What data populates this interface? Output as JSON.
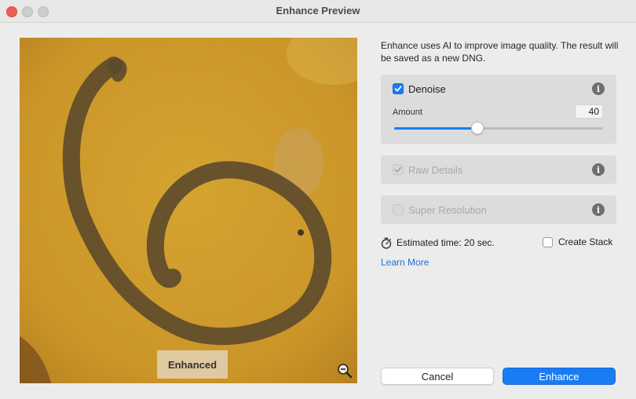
{
  "window": {
    "title": "Enhance Preview"
  },
  "preview": {
    "badge_label": "Enhanced",
    "zoom_icon": "zoom-out-icon"
  },
  "panel": {
    "description": "Enhance uses AI to improve image quality. The result will be saved as a new DNG.",
    "denoise": {
      "label": "Denoise",
      "checked": true,
      "amount_label": "Amount",
      "amount_value": "40",
      "amount_fraction": 0.4
    },
    "raw_details": {
      "label": "Raw Details",
      "checked": true,
      "disabled": true
    },
    "super_resolution": {
      "label": "Super Resolution",
      "checked": false,
      "disabled": true
    },
    "estimated_time": "Estimated time: 20 sec.",
    "create_stack": {
      "label": "Create Stack",
      "checked": false
    },
    "learn_more": "Learn More"
  },
  "buttons": {
    "cancel": "Cancel",
    "enhance": "Enhance"
  },
  "colors": {
    "accent": "#1a7cf5",
    "link": "#1a6fd8",
    "close_light": "#ee5e57",
    "preview_base": "#d29a25"
  }
}
